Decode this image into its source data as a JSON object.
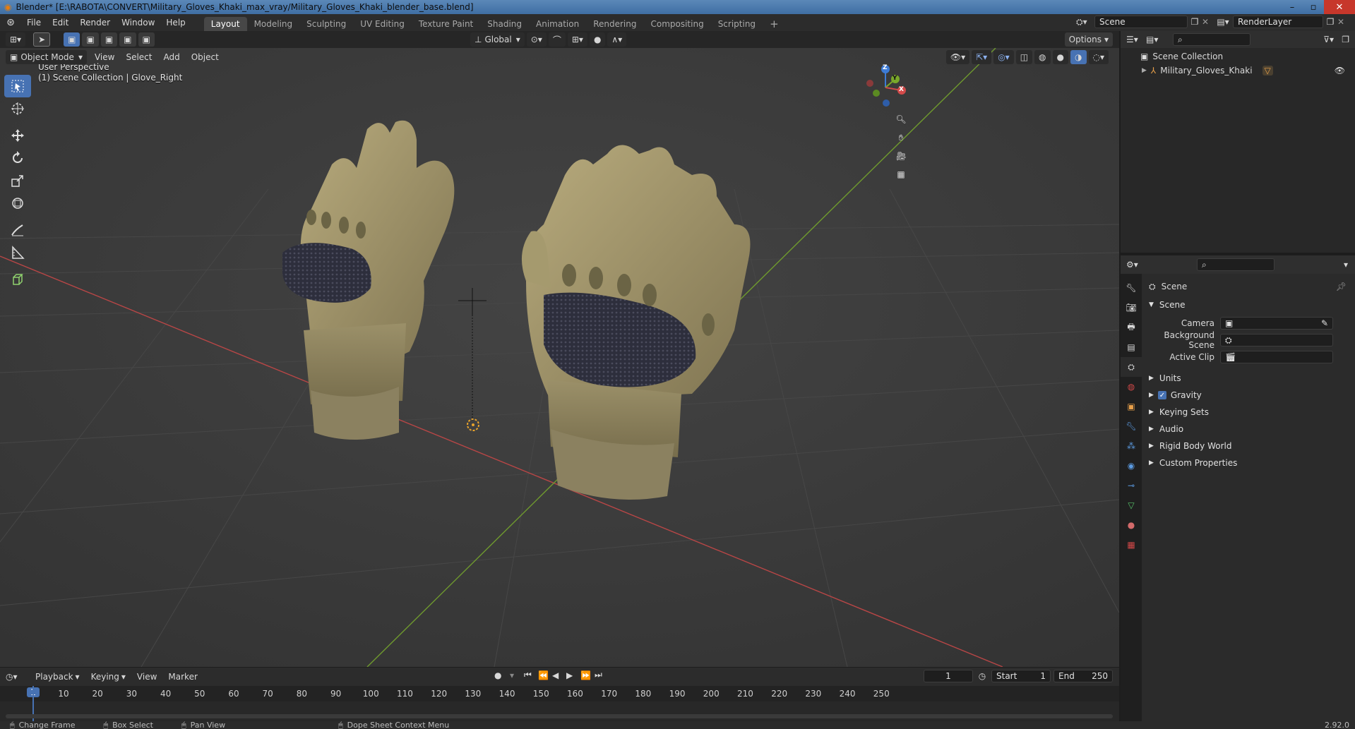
{
  "window": {
    "title": "Blender* [E:\\RABOTA\\CONVERT\\Military_Gloves_Khaki_max_vray/Military_Gloves_Khaki_blender_base.blend]"
  },
  "menu": [
    "File",
    "Edit",
    "Render",
    "Window",
    "Help"
  ],
  "workspaces": [
    {
      "label": "Layout",
      "active": true
    },
    {
      "label": "Modeling"
    },
    {
      "label": "Sculpting"
    },
    {
      "label": "UV Editing"
    },
    {
      "label": "Texture Paint"
    },
    {
      "label": "Shading"
    },
    {
      "label": "Animation"
    },
    {
      "label": "Rendering"
    },
    {
      "label": "Compositing"
    },
    {
      "label": "Scripting"
    }
  ],
  "scene_field": "Scene",
  "view_layer_field": "RenderLayer",
  "viewport_header": {
    "mode": "Object Mode",
    "menus": [
      "View",
      "Select",
      "Add",
      "Object"
    ],
    "transform_orientation": "Global",
    "options": "Options"
  },
  "viewport": {
    "perspective": "User Perspective",
    "collection_info": "(1) Scene Collection | Glove_Right",
    "gizmo_axes": {
      "x": "X",
      "y": "Y",
      "z": "Z"
    }
  },
  "outliner": {
    "root": "Scene Collection",
    "items": [
      {
        "label": "Military_Gloves_Khaki"
      }
    ]
  },
  "properties": {
    "context": "Scene",
    "panel_title": "Scene",
    "fields": [
      {
        "label": "Camera",
        "value": ""
      },
      {
        "label": "Background Scene",
        "value": ""
      },
      {
        "label": "Active Clip",
        "value": ""
      }
    ],
    "subpanels": [
      {
        "label": "Units",
        "checkbox": false
      },
      {
        "label": "Gravity",
        "checkbox": true
      },
      {
        "label": "Keying Sets",
        "checkbox": false
      },
      {
        "label": "Audio",
        "checkbox": false
      },
      {
        "label": "Rigid Body World",
        "checkbox": false
      },
      {
        "label": "Custom Properties",
        "checkbox": false
      }
    ]
  },
  "timeline": {
    "menus": [
      "Playback",
      "Keying",
      "View",
      "Marker"
    ],
    "current_frame": "1",
    "start_label": "Start",
    "start": "1",
    "end_label": "End",
    "end": "250",
    "ticks": [
      "1",
      "10",
      "20",
      "30",
      "40",
      "50",
      "60",
      "70",
      "80",
      "90",
      "100",
      "110",
      "120",
      "130",
      "140",
      "150",
      "160",
      "170",
      "180",
      "190",
      "200",
      "210",
      "220",
      "230",
      "240",
      "250"
    ]
  },
  "statusbar": {
    "items": [
      "Change Frame",
      "Box Select",
      "Pan View",
      "Dope Sheet Context Menu"
    ],
    "version": "2.92.0"
  },
  "colors": {
    "accent": "#4772b3",
    "viewport_bg": "#3b3b3b",
    "x_axis": "#c04040",
    "y_axis": "#7aa82a"
  }
}
